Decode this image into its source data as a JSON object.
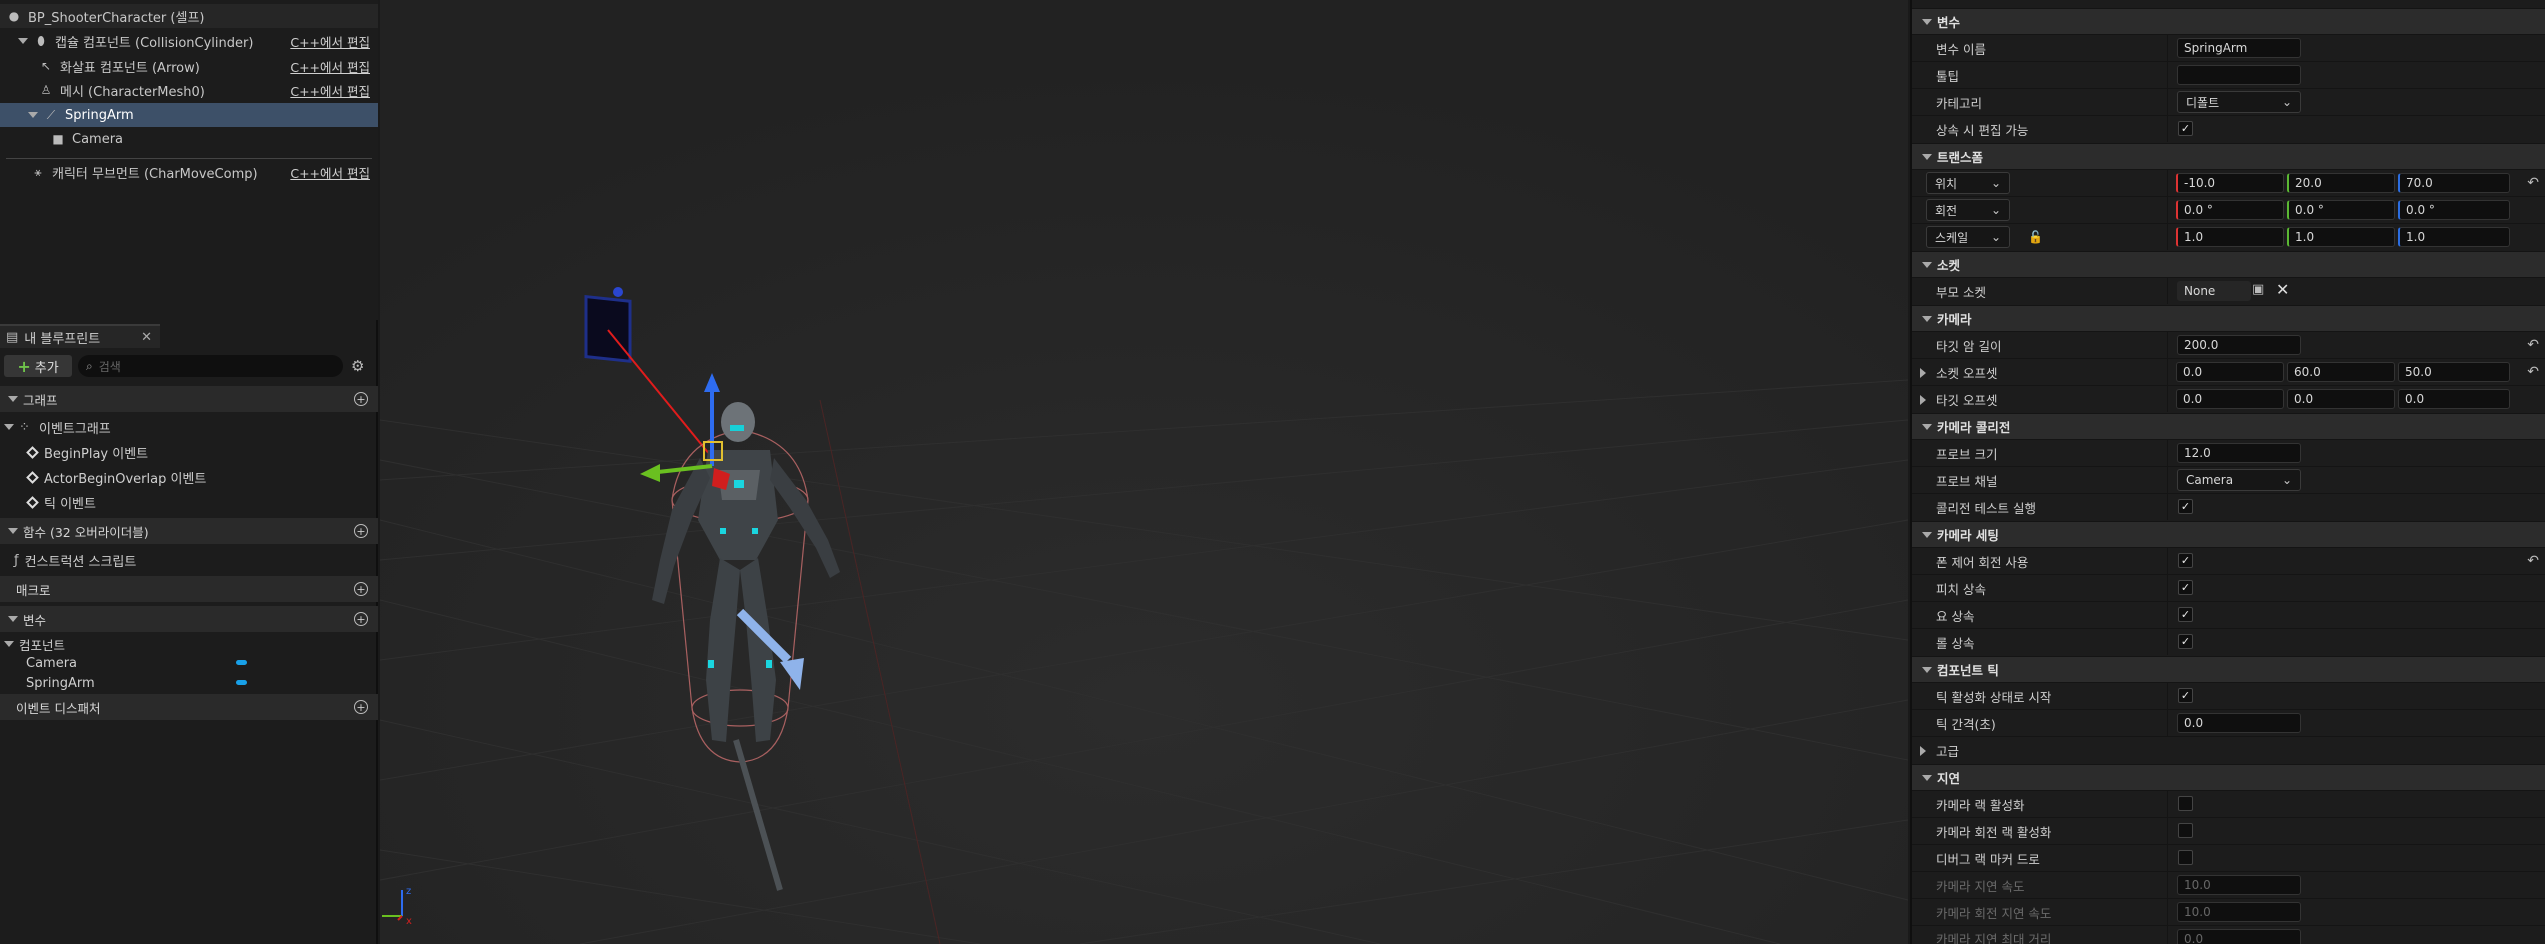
{
  "components": {
    "root": "BP_ShooterCharacter (셀프)",
    "items": [
      {
        "label": "캡슐 컴포넌트 (CollisionCylinder)",
        "edit": "C++에서 편집"
      },
      {
        "label": "화살표 컴포넌트 (Arrow)",
        "edit": "C++에서 편집"
      },
      {
        "label": "메시 (CharacterMesh0)",
        "edit": "C++에서 편집"
      },
      {
        "label": "SpringArm",
        "edit": ""
      },
      {
        "label": "Camera",
        "edit": ""
      },
      {
        "label": "캐릭터 무브먼트 (CharMoveComp)",
        "edit": "C++에서 편집"
      }
    ]
  },
  "my_blueprint": {
    "tab": "내 블루프린트",
    "close": "✕",
    "add": "추가",
    "search_placeholder": "검색",
    "graphs_header": "그래프",
    "event_graph": "이벤트그래프",
    "events": [
      "BeginPlay 이벤트",
      "ActorBeginOverlap 이벤트",
      "틱 이벤트"
    ],
    "functions_header": "함수 (32 오버라이더블)",
    "construction_script": "컨스트럭션 스크립트",
    "macros_header": "매크로",
    "variables_header": "변수",
    "components_group": "컴포넌트",
    "component_vars": [
      "Camera",
      "SpringArm"
    ],
    "dispatchers_header": "이벤트 디스패처"
  },
  "details": {
    "variable": {
      "header": "변수",
      "name_label": "변수 이름",
      "name_value": "SpringArm",
      "tooltip_label": "툴팁",
      "category_label": "카테고리",
      "category_value": "디폴트",
      "editable_label": "상속 시 편집 가능"
    },
    "transform": {
      "header": "트랜스폼",
      "location": "위치",
      "rotation": "회전",
      "scale": "스케일",
      "loc": [
        "-10.0",
        "20.0",
        "70.0"
      ],
      "rot": [
        "0.0 °",
        "0.0 °",
        "0.0 °"
      ],
      "scl": [
        "1.0",
        "1.0",
        "1.0"
      ]
    },
    "sockets": {
      "header": "소켓",
      "parent_label": "부모 소켓",
      "parent_value": "None"
    },
    "camera": {
      "header": "카메라",
      "target_arm_label": "타깃 암 길이",
      "target_arm_value": "200.0",
      "socket_offset_label": "소켓 오프셋",
      "socket_offset": [
        "0.0",
        "60.0",
        "50.0"
      ],
      "target_offset_label": "타깃 오프셋",
      "target_offset": [
        "0.0",
        "0.0",
        "0.0"
      ]
    },
    "camera_collision": {
      "header": "카메라 콜리전",
      "probe_size_label": "프로브 크기",
      "probe_size_value": "12.0",
      "probe_channel_label": "프로브 채널",
      "probe_channel_value": "Camera",
      "collision_test_label": "콜리전 테스트 실행"
    },
    "camera_settings": {
      "header": "카메라 세팅",
      "pawn_control_label": "폰 제어 회전 사용",
      "inherit_pitch_label": "피치 상속",
      "inherit_yaw_label": "요 상속",
      "inherit_roll_label": "롤 상속"
    },
    "component_tick": {
      "header": "컴포넌트 틱",
      "start_enabled_label": "틱 활성화 상태로 시작",
      "interval_label": "틱 간격(초)",
      "interval_value": "0.0"
    },
    "advanced": "고급",
    "lag": {
      "header": "지연",
      "camera_lag_label": "카메라 랙 활성화",
      "rotation_lag_label": "카메라 회전 랙 활성화",
      "debug_markers_label": "디버그 랙 마커 드로",
      "lag_speed_label": "카메라 지연 속도",
      "lag_speed_value": "10.0",
      "rot_lag_speed_label": "카메라 회전 지연 속도",
      "rot_lag_speed_value": "10.0",
      "max_lag_label": "카메라 지연 최대 거리",
      "max_lag_value": "0.0"
    }
  },
  "axis_labels": {
    "x": "x",
    "z": "z"
  }
}
